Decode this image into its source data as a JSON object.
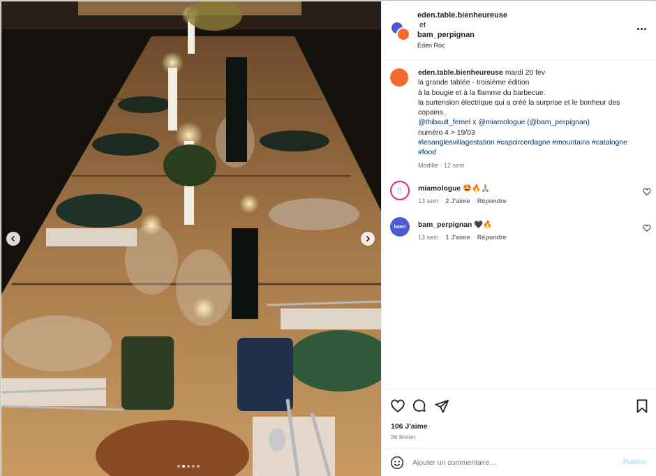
{
  "post": {
    "header": {
      "user1": "eden.table.bienheureuse",
      "joiner": "et",
      "user2": "bam_perpignan",
      "location": "Eden Roc"
    },
    "caption": {
      "username": "eden.table.bienheureuse",
      "date": "mardi 20 fev",
      "line1": "la grande tablée - troisième édition",
      "line2": "à la bougie et à la flamme du barbecue.",
      "line3": "la surtension électrique qui a créé la surprise et le bonheur des copains.",
      "mention1": "@thibault_femel",
      "x": "x",
      "mention2": "@miamologue",
      "mention3": "(@bam_perpignan",
      "close": ")",
      "line5": "numéro 4 > 19/03",
      "tags": [
        "#lesanglesvillagestation",
        "#capcircerdagne",
        "#mountains",
        "#catalogne",
        "#food"
      ],
      "edited": "Modifié",
      "sep": "·",
      "age": "12 sem"
    },
    "comments": [
      {
        "username": "miamologue",
        "text": "🤩🔥🙏🏼",
        "age": "13 sem",
        "likes": "2 J'aime",
        "reply": "Répondre",
        "avatar_glyph": "🍴"
      },
      {
        "username": "bam_perpignan",
        "text": "🖤🔥",
        "age": "13 sem",
        "likes": "1 J'aime",
        "reply": "Répondre",
        "avatar_glyph": "bam!"
      }
    ],
    "likes": "106 J'aime",
    "date": "26 février",
    "add_comment": {
      "placeholder": "Ajouter un commentaire…",
      "publish": "Publier"
    },
    "carousel": {
      "slides": 5,
      "active": 1
    },
    "icons": [
      "chevron-left-icon",
      "chevron-right-icon",
      "more-icon",
      "heart-icon",
      "comment-icon",
      "share-icon",
      "bookmark-icon",
      "emoji-icon"
    ],
    "colors": {
      "link": "#00376b",
      "muted": "#737373",
      "publish": "#b2dffc",
      "accent_orange": "#f26a2e",
      "accent_blue": "#4c5bd4"
    }
  }
}
